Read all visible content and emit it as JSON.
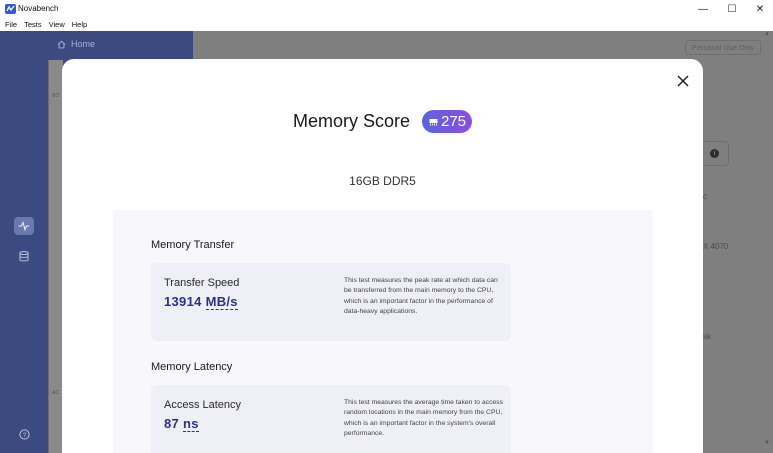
{
  "window": {
    "title": "Novabench",
    "controls": {
      "minimize": "—",
      "maximize": "☐",
      "close": "✕"
    }
  },
  "menu": [
    "File",
    "Tests",
    "View",
    "Help"
  ],
  "background": {
    "nav_home": "Home",
    "personal_use": "Personal Use Only",
    "info_glyph": "i",
    "peek_texts": [
      "c",
      "X 4070",
      "sk"
    ],
    "side_labels": [
      "BO",
      "AC"
    ]
  },
  "modal": {
    "title": "Memory Score",
    "score": "275",
    "subtitle": "16GB DDR5",
    "sections": [
      {
        "heading": "Memory Transfer",
        "test_name": "Transfer Speed",
        "value": "13914",
        "unit": "MB/s",
        "description": "This test measures the peak rate at which data can be transferred from the main memory to the CPU, which is an important factor in the performance of data-heavy applications."
      },
      {
        "heading": "Memory Latency",
        "test_name": "Access Latency",
        "value": "87",
        "unit": "ns",
        "description": "This test measures the average time taken to access random locations in the main memory from the CPU, which is an important factor in the system's overall performance."
      }
    ]
  },
  "icons": {
    "app": "novabench-app-icon",
    "home": "home-icon",
    "activity": "activity-icon",
    "database": "database-icon",
    "help": "help-icon",
    "close": "close-icon",
    "badge": "memory-chip-icon"
  },
  "colors": {
    "sidebar": "#3c4a82",
    "badge_start": "#5d63e0",
    "badge_end": "#8a4fe0",
    "score_value": "#2c2f8c"
  }
}
